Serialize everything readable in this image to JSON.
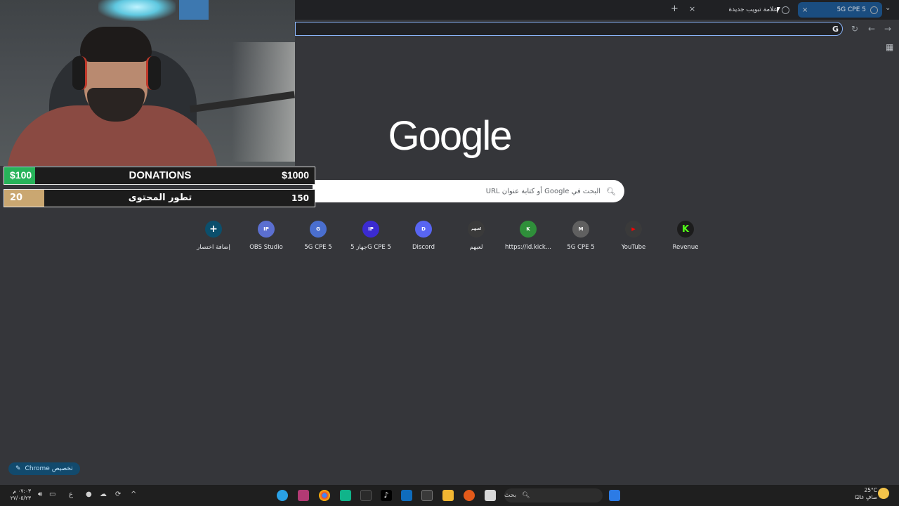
{
  "browser": {
    "tabs": [
      {
        "label": "5G CPE 5",
        "active": true
      },
      {
        "label": "علامة تبويب جديدة",
        "active": false
      }
    ],
    "new_tab_symbol": "+",
    "close_symbol": "×",
    "omnibox_icon": "G"
  },
  "newtab": {
    "logo_text": "Google",
    "search_placeholder": "البحث في Google أو كتابة عنوان URL",
    "shortcuts": [
      {
        "label": "إضافة اختصار",
        "badge": "+",
        "color": "#0b4f6c"
      },
      {
        "label": "OBS Studio",
        "badge": "IP",
        "color": "#5b6fd0"
      },
      {
        "label": "5G CPE 5",
        "badge": "G",
        "color": "#4a6fcf"
      },
      {
        "label": "جهاز 5G CPE 5",
        "badge": "IP",
        "color": "#3b2bd1"
      },
      {
        "label": "Discord",
        "badge": "D",
        "color": "#5865f2"
      },
      {
        "label": "لعبهم",
        "badge": "لعبهم",
        "color": "#3a3a3a"
      },
      {
        "label": "https://id.kick...",
        "badge": "K",
        "color": "#2f8f3a"
      },
      {
        "label": "5G CPE 5",
        "badge": "M",
        "color": "#606060"
      },
      {
        "label": "YouTube",
        "badge": "▶",
        "color": "#3a3a3a"
      },
      {
        "label": "Revenue",
        "badge": "K",
        "color": "#1c1c1c"
      }
    ],
    "customize_label": "تخصيص Chrome"
  },
  "overlay": {
    "donations": {
      "current": "$100",
      "title": "DONATIONS",
      "goal": "$1000",
      "progress": 0.1
    },
    "content": {
      "current": "20",
      "title": "تطور المحتوى",
      "goal": "150",
      "progress": 0.13
    }
  },
  "taskbar": {
    "search_label": "بحث",
    "clock_time": "٠٧:٠٣ م",
    "clock_date": "٢٧/٠٥/٢٣",
    "lang": "ع",
    "weather_temp": "25°C",
    "weather_desc": "صافٍ غالبًا"
  }
}
